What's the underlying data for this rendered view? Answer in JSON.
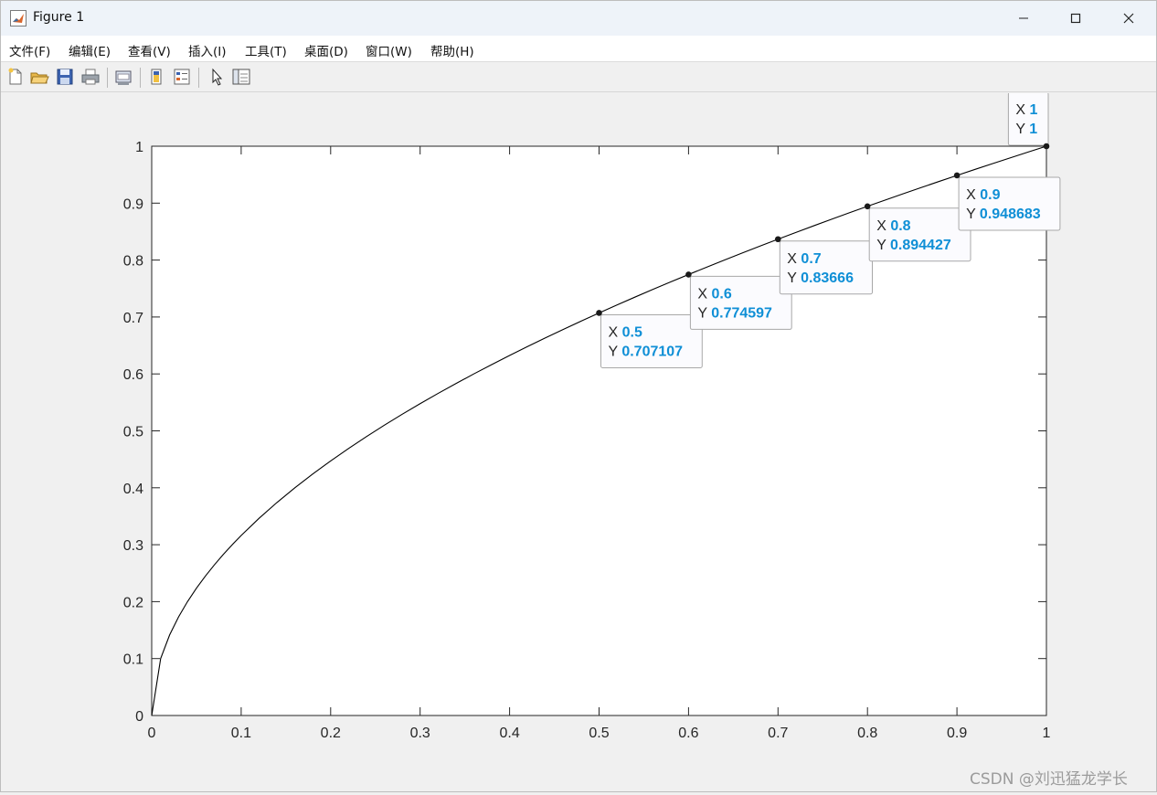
{
  "window": {
    "title": "Figure 1"
  },
  "menu": [
    "文件(F)",
    "编辑(E)",
    "查看(V)",
    "插入(I)",
    "工具(T)",
    "桌面(D)",
    "窗口(W)",
    "帮助(H)"
  ],
  "toolbar": [
    {
      "name": "new-figure-icon"
    },
    {
      "name": "open-file-icon"
    },
    {
      "name": "save-icon"
    },
    {
      "name": "print-icon"
    },
    {
      "name": "link-plot-icon"
    },
    {
      "name": "colorbar-icon"
    },
    {
      "name": "legend-icon"
    },
    {
      "name": "pointer-icon"
    },
    {
      "name": "property-editor-icon"
    }
  ],
  "chart_data": {
    "type": "line",
    "title": "",
    "xlabel": "",
    "ylabel": "",
    "xlim": [
      0,
      1
    ],
    "ylim": [
      0,
      1
    ],
    "xticks": [
      "0",
      "0.1",
      "0.2",
      "0.3",
      "0.4",
      "0.5",
      "0.6",
      "0.7",
      "0.8",
      "0.9",
      "1"
    ],
    "yticks": [
      "0",
      "0.1",
      "0.2",
      "0.3",
      "0.4",
      "0.5",
      "0.6",
      "0.7",
      "0.8",
      "0.9",
      "1"
    ],
    "grid": false,
    "series": [
      {
        "x": [
          0,
          0.01,
          0.02,
          0.03,
          0.04,
          0.05,
          0.06,
          0.07,
          0.08,
          0.09,
          0.1,
          0.12,
          0.14,
          0.16,
          0.18,
          0.2,
          0.22,
          0.24,
          0.26,
          0.28,
          0.3,
          0.32,
          0.34,
          0.36,
          0.38,
          0.4,
          0.42,
          0.44,
          0.46,
          0.48,
          0.5,
          0.52,
          0.54,
          0.56,
          0.58,
          0.6,
          0.62,
          0.64,
          0.66,
          0.68,
          0.7,
          0.72,
          0.74,
          0.76,
          0.78,
          0.8,
          0.82,
          0.84,
          0.86,
          0.88,
          0.9,
          0.92,
          0.94,
          0.96,
          0.98,
          1
        ],
        "y": [
          0,
          0.1,
          0.141421,
          0.173205,
          0.2,
          0.223607,
          0.244949,
          0.264575,
          0.282843,
          0.3,
          0.316228,
          0.34641,
          0.374166,
          0.4,
          0.424264,
          0.447214,
          0.469042,
          0.489898,
          0.509902,
          0.52915,
          0.547723,
          0.565685,
          0.583095,
          0.6,
          0.616441,
          0.632456,
          0.648074,
          0.663325,
          0.678233,
          0.69282,
          0.707107,
          0.72111,
          0.734847,
          0.748331,
          0.761577,
          0.774597,
          0.787401,
          0.8,
          0.812404,
          0.824621,
          0.83666,
          0.848528,
          0.860233,
          0.87178,
          0.883176,
          0.894427,
          0.905539,
          0.916515,
          0.927362,
          0.938083,
          0.948683,
          0.959166,
          0.969536,
          0.979796,
          0.989949,
          1
        ],
        "color": "#000000"
      }
    ],
    "datatips": [
      {
        "x": "0.5",
        "y": "0.707107",
        "xv": 0.5,
        "yv": 0.707107,
        "side": "below"
      },
      {
        "x": "0.6",
        "y": "0.774597",
        "xv": 0.6,
        "yv": 0.774597,
        "side": "below"
      },
      {
        "x": "0.7",
        "y": "0.83666",
        "xv": 0.7,
        "yv": 0.83666,
        "side": "below"
      },
      {
        "x": "0.8",
        "y": "0.894427",
        "xv": 0.8,
        "yv": 0.894427,
        "side": "below"
      },
      {
        "x": "0.9",
        "y": "0.948683",
        "xv": 0.9,
        "yv": 0.948683,
        "side": "below"
      },
      {
        "x": "1",
        "y": "1",
        "xv": 1,
        "yv": 1,
        "side": "above"
      }
    ],
    "datatip_labels": {
      "x": "X",
      "y": "Y"
    },
    "value_color": "#0f8fd6"
  },
  "watermark": "CSDN @刘迅猛龙学长"
}
